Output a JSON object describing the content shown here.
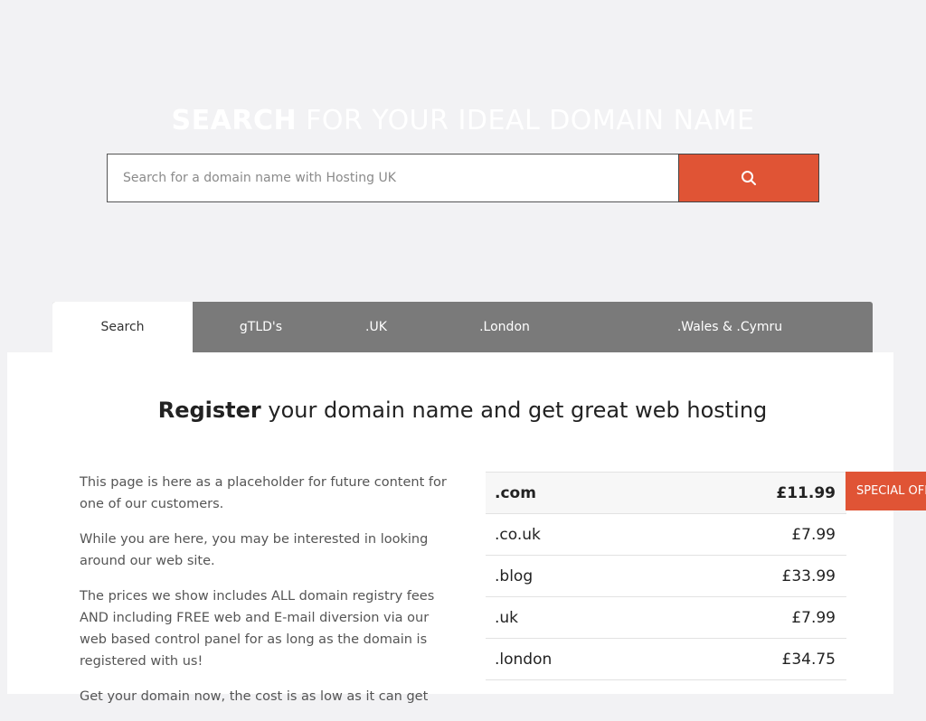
{
  "hero": {
    "title_strong": "SEARCH",
    "title_rest": " FOR YOUR IDEAL DOMAIN NAME",
    "search_placeholder": "Search for a domain name with Hosting UK",
    "search_value": "",
    "search_button_icon": "search-icon"
  },
  "tabs": [
    {
      "label": "Search",
      "active": true
    },
    {
      "label": "gTLD's",
      "active": false
    },
    {
      "label": ".UK",
      "active": false
    },
    {
      "label": ".London",
      "active": false
    },
    {
      "label": ".Wales & .Cymru",
      "active": false
    }
  ],
  "panel": {
    "heading_strong": "Register",
    "heading_rest": " your domain name and get great web hosting",
    "paragraphs": [
      "This page is here as a placeholder for future content for one of our customers.",
      "While you are here, you may be interested in looking around our web site.",
      "The prices we show includes ALL domain registry fees AND including FREE web and E-mail diversion via our web based control panel for as long as the domain is registered with us!",
      "Get your domain now, the cost is as low as it can get"
    ],
    "prices": [
      {
        "tld": ".com",
        "price": "£11.99",
        "featured": true
      },
      {
        "tld": ".co.uk",
        "price": "£7.99",
        "featured": false
      },
      {
        "tld": ".blog",
        "price": "£33.99",
        "featured": false
      },
      {
        "tld": ".uk",
        "price": "£7.99",
        "featured": false
      },
      {
        "tld": ".london",
        "price": "£34.75",
        "featured": false
      }
    ],
    "special_offer": "SPECIAL OFFER"
  },
  "colors": {
    "accent": "#e05435",
    "tab_bar": "#7a7a7a",
    "page_bg": "#f2f2f4"
  }
}
